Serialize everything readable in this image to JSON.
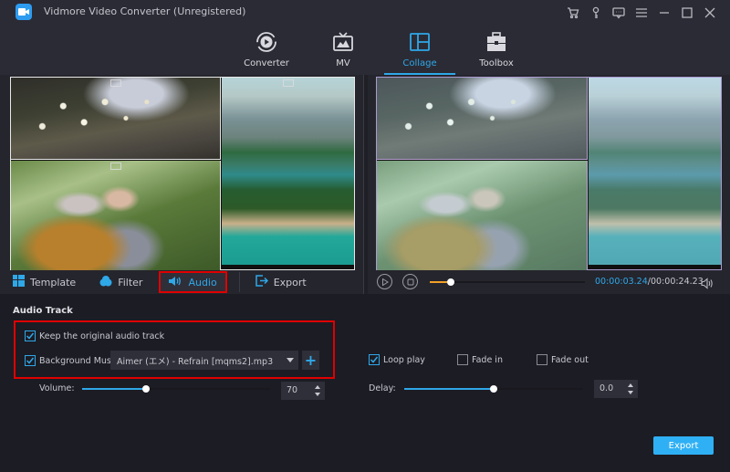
{
  "window": {
    "title": "Vidmore Video Converter (Unregistered)",
    "controls": [
      "cart-icon",
      "key-icon",
      "feedback-icon",
      "menu-icon",
      "minimize-icon",
      "maximize-icon",
      "close-icon"
    ]
  },
  "nav": {
    "items": [
      {
        "label": "Converter",
        "icon": "converter-icon",
        "active": false
      },
      {
        "label": "MV",
        "icon": "mv-icon",
        "active": false
      },
      {
        "label": "Collage",
        "icon": "collage-icon",
        "active": true
      },
      {
        "label": "Toolbox",
        "icon": "toolbox-icon",
        "active": false
      }
    ]
  },
  "editor_tabs": {
    "items": [
      {
        "label": "Template",
        "icon": "template-icon"
      },
      {
        "label": "Filter",
        "icon": "filter-icon"
      },
      {
        "label": "Audio",
        "icon": "audio-icon",
        "active": true
      },
      {
        "label": "Export",
        "icon": "export-icon"
      }
    ]
  },
  "player": {
    "current_time": "00:00:03.24",
    "total_time": "/00:00:24.23",
    "progress_fraction": 0.134
  },
  "audio": {
    "section_title": "Audio Track",
    "keep_original": {
      "label": "Keep the original audio track",
      "checked": true
    },
    "background_music": {
      "label": "Background Music",
      "checked": true,
      "selected": "Aimer (エメ) - Refrain [mqms2].mp3",
      "add_label": "+"
    },
    "loop_play": {
      "label": "Loop play",
      "checked": true
    },
    "fade_in": {
      "label": "Fade in",
      "checked": false
    },
    "fade_out": {
      "label": "Fade out",
      "checked": false
    },
    "volume": {
      "label": "Volume:",
      "value": "70",
      "fraction": 0.34
    },
    "delay": {
      "label": "Delay:",
      "value": "0.0",
      "fraction": 0.5
    }
  },
  "export_button": "Export",
  "colors": {
    "accent": "#2fa8e8",
    "progress": "#f2a028",
    "highlight": "#e00000",
    "export_button": "#2fb0f5"
  }
}
